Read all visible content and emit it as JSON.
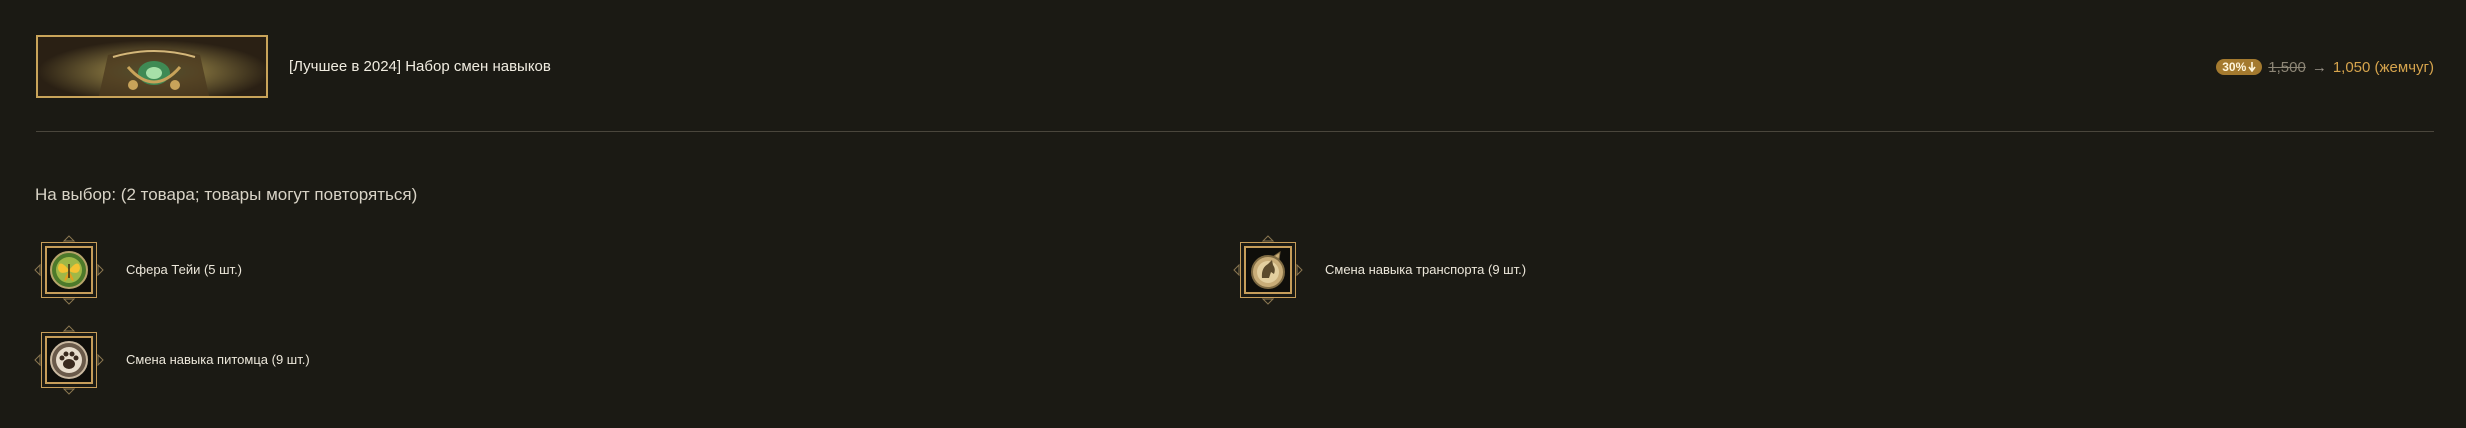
{
  "product": {
    "title": "[Лучшее в 2024] Набор смен навыков",
    "banner_icon": "treasure-chest-image"
  },
  "price": {
    "discount": "30%",
    "discount_icon": "down-arrow-icon",
    "old_price": "1,500",
    "arrow": "→",
    "new_price": "1,050 (жемчуг)"
  },
  "choice": {
    "heading": "На выбор: (2 товара; товары могут повторяться)",
    "items": [
      {
        "label": "Сфера Тейи (5 шт.)",
        "icon": "butterfly-orb-icon"
      },
      {
        "label": "Смена навыка транспорта (9 шт.)",
        "icon": "horse-skill-icon"
      },
      {
        "label": "Смена навыка питомца (9 шт.)",
        "icon": "paw-skill-icon"
      }
    ]
  },
  "colors": {
    "background": "#1b1a14",
    "accent_gold": "#c69d5a",
    "price_orange": "#d6a44d"
  }
}
